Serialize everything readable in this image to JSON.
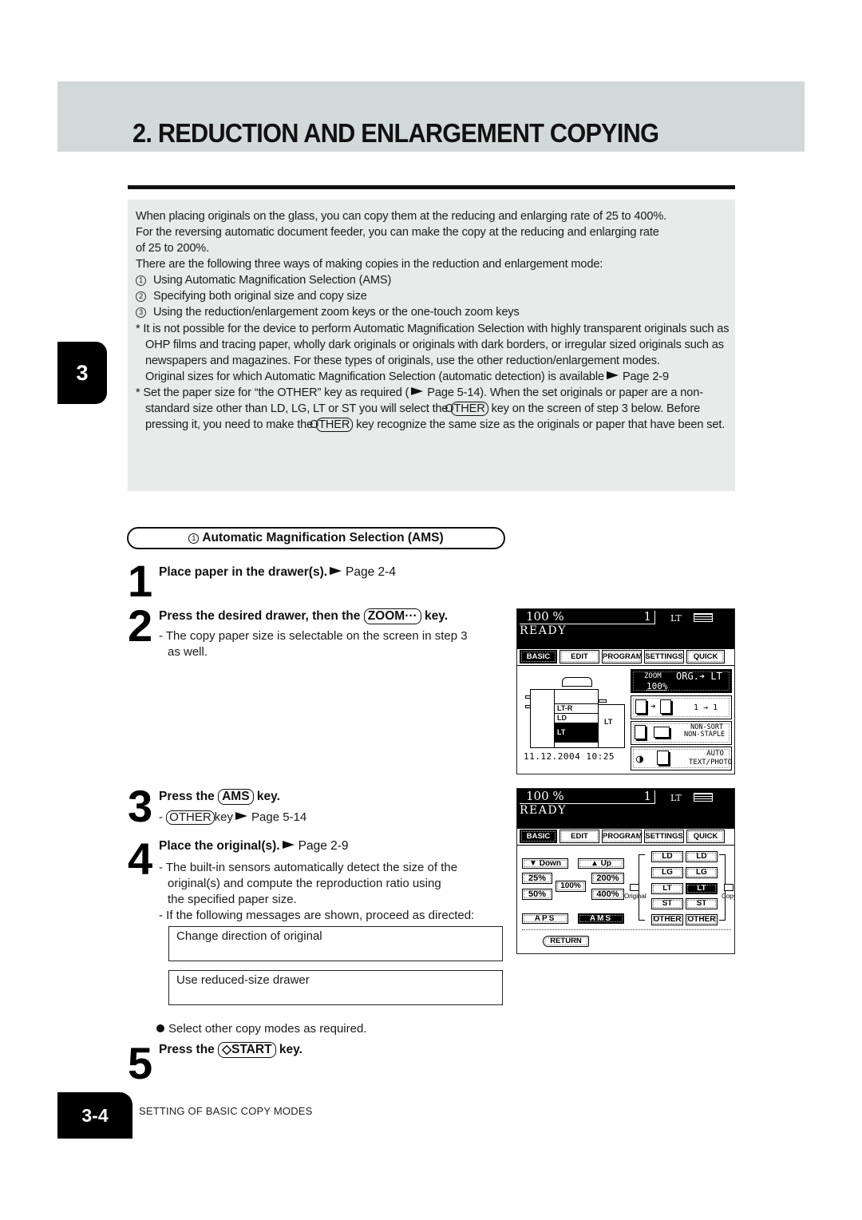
{
  "page": {
    "title": "2. REDUCTION AND ENLARGEMENT COPYING",
    "chapter_tab": "3",
    "footer_page": "3-4",
    "footer_section": "SETTING OF BASIC COPY MODES"
  },
  "intro": {
    "line1": "When placing originals on the glass, you can copy them at the reducing and enlarging rate of 25 to 400%.",
    "line2": "For the reversing automatic document feeder, you can make the copy at the reducing and enlarging rate",
    "line3": "of 25 to 200%.",
    "line4": "There are the following three ways of making copies in the reduction and enlargement mode:",
    "ways": [
      {
        "num": "1",
        "text": "Using Automatic Magnification Selection (AMS)"
      },
      {
        "num": "2",
        "text": "Specifying both original size and copy size"
      },
      {
        "num": "3",
        "text": "Using the reduction/enlargement zoom keys or the one-touch zoom keys"
      }
    ],
    "note1": "* It is not possible for the device to perform Automatic Magnification Selection with highly transparent originals such as OHP films and tracing paper, wholly dark originals or originals with dark borders, or irregular sized originals such as newspapers and magazines. For these types of originals, use the other reduction/enlargement modes.",
    "note1_ref_text": "Original sizes for which Automatic Magnification Selection (automatic detection) is available",
    "note1_ref_page": "Page 2-9",
    "note2_a": "* Set the paper size for “the OTHER” key as required (",
    "note2_a_page": "Page 5-14",
    "note2_b": "). When the set originals or paper are a non-standard size other than LD, LG, LT or ST you will select the",
    "note2_key": "OTHER",
    "note2_c": "key on the screen of step 3 below. Before pressing it, you need to make the",
    "note2_d": "key recognize the same size as the originals or paper that have been set."
  },
  "section": {
    "num": "1",
    "title": "Automatic Magnification Selection (AMS)"
  },
  "steps": [
    {
      "num": "1",
      "head": "Place paper in the drawer(s).",
      "ref": "Page 2-4"
    },
    {
      "num": "2",
      "head_a": "Press the desired drawer, then the",
      "key": "ZOOM···",
      "head_b": "key.",
      "text": "- The copy paper size is selectable on the screen in step 3",
      "text2": "as well."
    },
    {
      "num": "3",
      "head_a": "Press the",
      "key": "AMS",
      "head_b": "key.",
      "sub_a": "-",
      "sub_key": "OTHER",
      "sub_b": "key",
      "sub_ref": "Page 5-14"
    },
    {
      "num": "4",
      "head": "Place the original(s).",
      "ref": "Page 2-9",
      "text1": "- The built-in sensors automatically detect the size of the",
      "text2": "original(s) and compute the reproduction ratio using",
      "text3": "the specified paper size.",
      "text4": "- If the following messages are shown, proceed as directed:",
      "messages": [
        "Change direction of original",
        "Use reduced-size drawer"
      ]
    },
    {
      "num": "5",
      "bullet": "Select other copy modes as required.",
      "head_a": "Press the",
      "key": "◇START",
      "head_b": "key."
    }
  ],
  "screen1": {
    "ratio": "100  %",
    "count": "1",
    "paper": "LT",
    "status": "READY",
    "tabs": [
      "BASIC",
      "EDIT",
      "PROGRAM",
      "SETTINGS",
      "QUICK"
    ],
    "active_tab": "BASIC",
    "drawers": [
      "LT-R",
      "LD",
      "LT"
    ],
    "selected_drawer": "LT",
    "bypass_label": "LT",
    "datetime": "11.12.2004 10:25",
    "zoom_label": "ZOOM",
    "zoom_value": "100%",
    "zoom_org": "ORG.➔ LT",
    "duplex": "1 → 1",
    "finishing_1": "NON-SORT",
    "finishing_2": "NON-STAPLE",
    "image_1": "AUTO",
    "image_2": "TEXT/PHOTO"
  },
  "screen2": {
    "ratio": "100  %",
    "count": "1",
    "paper": "LT",
    "status": "READY",
    "tabs": [
      "BASIC",
      "EDIT",
      "PROGRAM",
      "SETTINGS",
      "QUICK"
    ],
    "active_tab": "BASIC",
    "down": "▼ Down",
    "up": "▲  Up",
    "zoom_presets": [
      "25%",
      "50%",
      "100%",
      "200%",
      "400%"
    ],
    "aps": "APS",
    "ams": "AMS",
    "ams_selected": true,
    "original_label": "Original",
    "copy_label": "Copy",
    "original_sizes": [
      "LD",
      "LG",
      "LT",
      "ST",
      "OTHER"
    ],
    "copy_sizes": [
      "LD",
      "LG",
      "LT",
      "ST",
      "OTHER"
    ],
    "copy_selected": "LT",
    "return": "RETURN"
  }
}
